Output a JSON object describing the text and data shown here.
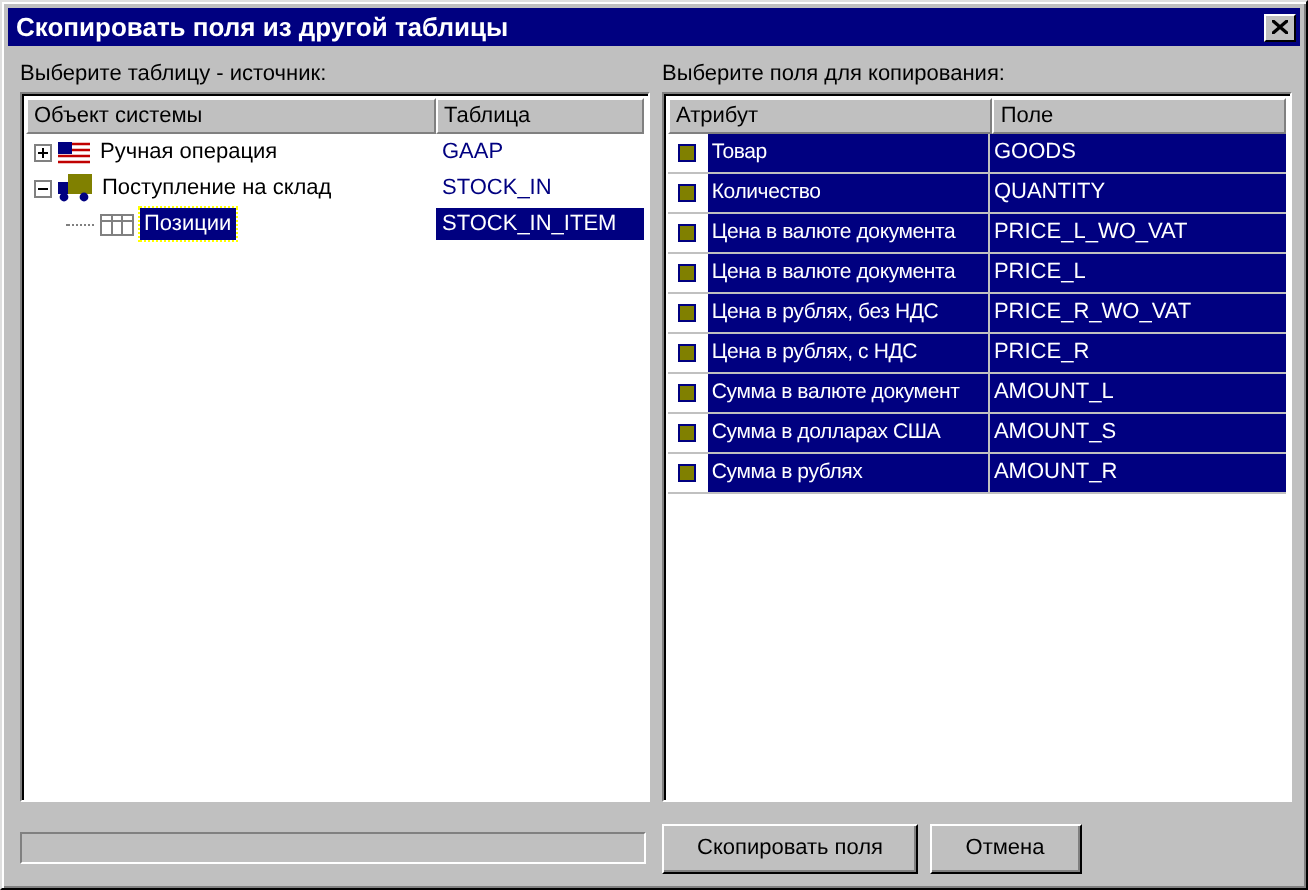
{
  "window": {
    "title": "Скопировать поля из другой таблицы"
  },
  "source": {
    "label": "Выберите таблицу - источник:",
    "columns": [
      "Объект системы",
      "Таблица"
    ],
    "items": [
      {
        "name": "Ручная операция",
        "table": "GAAP",
        "expanded": false,
        "selected": false
      },
      {
        "name": "Поступление на склад",
        "table": "STOCK_IN",
        "expanded": true,
        "selected": false,
        "children": [
          {
            "name": "Позиции",
            "table": "STOCK_IN_ITEM",
            "selected": true
          }
        ]
      }
    ]
  },
  "fields": {
    "label": "Выберите поля для копирования:",
    "columns": [
      "Атрибут",
      "Поле"
    ],
    "rows": [
      {
        "attribute": "Товар",
        "field": "GOODS",
        "selected": true
      },
      {
        "attribute": "Количество",
        "field": "QUANTITY",
        "selected": true
      },
      {
        "attribute": "Цена в валюте документа",
        "field": "PRICE_L_WO_VAT",
        "selected": true
      },
      {
        "attribute": "Цена в валюте документа",
        "field": "PRICE_L",
        "selected": true
      },
      {
        "attribute": "Цена в рублях, без НДС",
        "field": "PRICE_R_WO_VAT",
        "selected": true
      },
      {
        "attribute": "Цена в рублях, с НДС",
        "field": "PRICE_R",
        "selected": true
      },
      {
        "attribute": "Сумма в валюте документ",
        "field": "AMOUNT_L",
        "selected": true
      },
      {
        "attribute": "Сумма в долларах США",
        "field": "AMOUNT_S",
        "selected": true
      },
      {
        "attribute": "Сумма в рублях",
        "field": "AMOUNT_R",
        "selected": true
      }
    ]
  },
  "progress": {
    "level": 0
  },
  "buttons": [
    "Скопировать поля",
    "Отмена"
  ]
}
